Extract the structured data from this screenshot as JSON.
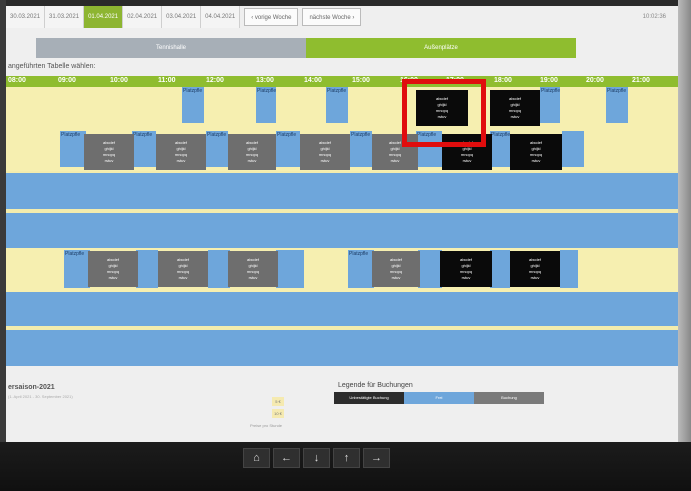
{
  "date_tabs": [
    "30.03.2021",
    "31.03.2021",
    "01.04.2021",
    "02.04.2021",
    "03.04.2021",
    "04.04.2021"
  ],
  "active_tab_index": 2,
  "week_nav": {
    "prev": "vorige Woche",
    "next": "nächste Woche"
  },
  "clock": "10:02:36",
  "view_toggle": {
    "left": "Tennishalle",
    "right": "Außenplätze"
  },
  "table_title": "angeführten Tabelle wählen:",
  "time_labels": [
    "08:00",
    "09:00",
    "10:00",
    "11:00",
    "12:00",
    "13:00",
    "14:00",
    "15:00",
    "16:00",
    "17:00",
    "18:00",
    "19:00",
    "20:00",
    "21:00"
  ],
  "slot_label": "Platzpfle",
  "booking_lines": [
    "abcdef",
    "ghijkl",
    "mnopq",
    "rstuv"
  ],
  "season": {
    "title": "ersaison-2021",
    "sub": "(1. April 2021 - 30. September 2021)"
  },
  "prices": [
    "5 €",
    "10 €"
  ],
  "price_note": "Preise pro Stunde",
  "legend": {
    "title": "Legende für Buchungen",
    "items": [
      "Unbestätigte Buchung",
      "Frei",
      "Buchung"
    ],
    "colors": [
      "#2c2c2c",
      "#6ea6db",
      "#7a7a7a"
    ]
  },
  "nav_buttons": [
    "⌂",
    "←",
    "↓",
    "↑",
    "→"
  ],
  "colors": {
    "accent": "#8fbd2f",
    "free": "#6ea6db",
    "yellow": "#f6efb0",
    "highlight": "#e00d0d"
  }
}
